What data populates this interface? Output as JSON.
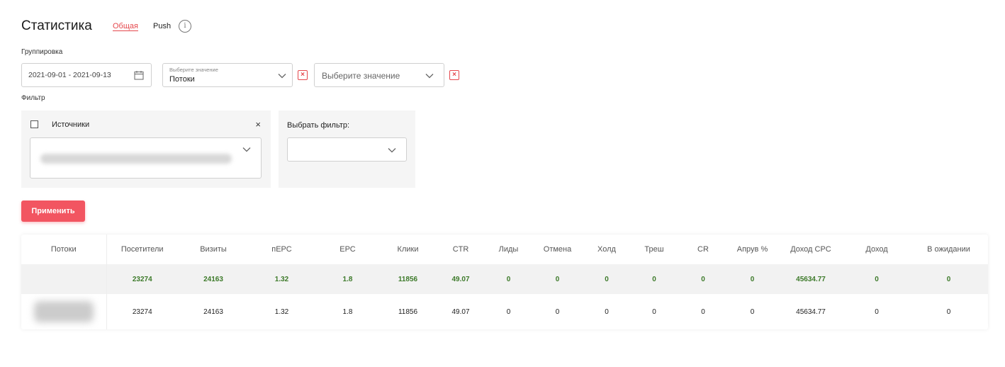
{
  "page": {
    "title": "Статистика",
    "tabs": [
      {
        "label": "Общая",
        "active": true
      },
      {
        "label": "Push",
        "active": false
      }
    ],
    "info_icon": "i"
  },
  "grouping": {
    "label": "Группировка",
    "date_range": "2021-09-01 - 2021-09-13",
    "select1": {
      "placeholder": "Выберите значение",
      "value": "Потоки"
    },
    "select2": {
      "placeholder": "Выберите значение"
    },
    "clear_glyph": "×"
  },
  "filter": {
    "label": "Фильтр",
    "sources": {
      "label": "Источники",
      "close": "×"
    },
    "choose_filter": {
      "label": "Выбрать фильтр:"
    }
  },
  "apply_label": "Применить",
  "table": {
    "headers": [
      "Потоки",
      "Посетители",
      "Визиты",
      "пЕРС",
      "ЕРС",
      "Клики",
      "CTR",
      "Лиды",
      "Отмена",
      "Холд",
      "Треш",
      "CR",
      "Апрув %",
      "Доход CPC",
      "Доход",
      "В ожидании"
    ],
    "total": [
      "",
      "23274",
      "24163",
      "1.32",
      "1.8",
      "11856",
      "49.07",
      "0",
      "0",
      "0",
      "0",
      "0",
      "0",
      "45634.77",
      "0",
      "0"
    ],
    "rows": [
      [
        "",
        "23274",
        "24163",
        "1.32",
        "1.8",
        "11856",
        "49.07",
        "0",
        "0",
        "0",
        "0",
        "0",
        "0",
        "45634.77",
        "0",
        "0"
      ]
    ]
  },
  "colors": {
    "accent": "#e5484d",
    "button": "#f25561",
    "total_text": "#3d7a2a"
  },
  "icons": [
    "info-icon",
    "calendar-icon",
    "chevron-down-icon",
    "close-icon",
    "checkbox-icon"
  ]
}
